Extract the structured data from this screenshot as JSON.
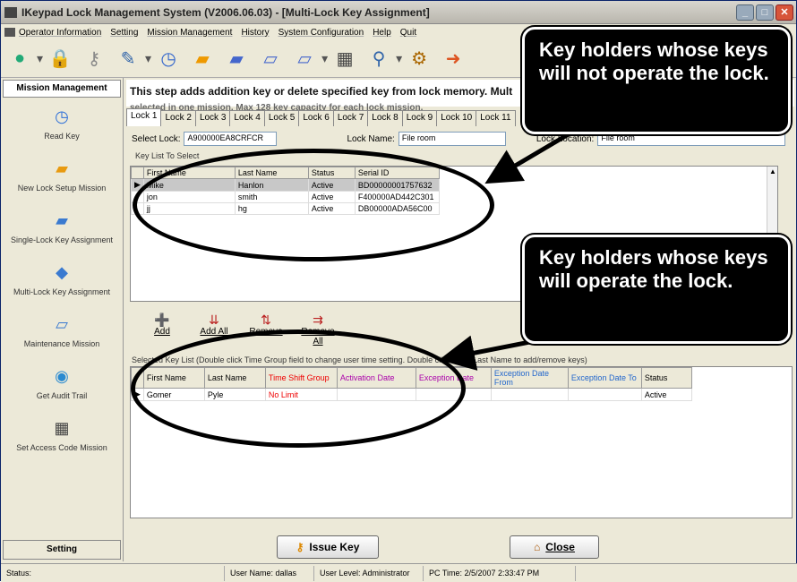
{
  "window": {
    "title": "IKeypad Lock Management System   (V2006.06.03) - [Multi-Lock Key Assignment]"
  },
  "menu": [
    "Operator Information",
    "Setting",
    "Mission Management",
    "History",
    "System Configuration",
    "Help",
    "Quit"
  ],
  "sidebar": {
    "header": "Mission Management",
    "items": [
      {
        "label": "Read Key",
        "icon": "clock-icon"
      },
      {
        "label": "New Lock Setup Mission",
        "icon": "folder-icon"
      },
      {
        "label": "Single-Lock Key Assignment",
        "icon": "folder-icon"
      },
      {
        "label": "Multi-Lock Key Assignment",
        "icon": "key-icon"
      },
      {
        "label": "Maintenance Mission",
        "icon": "tray-icon"
      },
      {
        "label": "Get Audit Trail",
        "icon": "audit-icon"
      },
      {
        "label": "Set Access Code Mission",
        "icon": "building-icon"
      }
    ],
    "footer": "Setting"
  },
  "main": {
    "description": "This step adds addition key or delete specified key from lock memory. Mult",
    "description2": "selected in one mission. Max 128 key capacity for each lock mission.",
    "tabs": [
      "Lock 1",
      "Lock 2",
      "Lock 3",
      "Lock 4",
      "Lock 5",
      "Lock 6",
      "Lock 7",
      "Lock 8",
      "Lock 9",
      "Lock 10",
      "Lock 11"
    ],
    "select_lock_label": "Select Lock:",
    "select_lock_value": "A900000EA8CRFCR",
    "lock_name_label": "Lock Name:",
    "lock_name_value": "File room",
    "lock_location_label": "Lock Location:",
    "lock_location_value": "File room",
    "key_list_label": "Key List To Select",
    "key_list": {
      "columns": [
        "First Name",
        "Last Name",
        "Status",
        "Serial ID"
      ],
      "rows": [
        [
          "Mike",
          "Hanlon",
          "Active",
          "BD00000001757632"
        ],
        [
          "jon",
          "smith",
          "Active",
          "F400000AD442C301"
        ],
        [
          "jj",
          "hg",
          "Active",
          "DB00000ADA56C00"
        ]
      ]
    },
    "actions": [
      {
        "label": "Add",
        "icon": "add-icon"
      },
      {
        "label": "Add All",
        "icon": "add-all-icon"
      },
      {
        "label": "Remove",
        "icon": "remove-icon"
      },
      {
        "label": "Remove All",
        "icon": "remove-all-icon"
      }
    ],
    "selected_info": "Selected Key List  (Double click Time Group field to change user time setting. Double click First, Last Name to add/remove keys)",
    "selected_list": {
      "columns": [
        "First Name",
        "Last Name",
        "Time Shift Group",
        "Activation Date",
        "Exception Date",
        "Exception Date From",
        "Exception Date To",
        "Status"
      ],
      "rows": [
        [
          "Gomer",
          "Pyle",
          "No Limit",
          "",
          "",
          "",
          "",
          "Active"
        ]
      ]
    },
    "issue_key": "Issue Key",
    "close": "Close"
  },
  "status": {
    "status": "Status:",
    "user_name": "User Name:  dallas",
    "user_level": "User Level:  Administrator",
    "pc_time": "PC Time:  2/5/2007 2:33:47 PM"
  },
  "callouts": {
    "top": "Key holders whose keys will not operate the lock.",
    "bottom": "Key holders whose keys will operate the lock."
  }
}
